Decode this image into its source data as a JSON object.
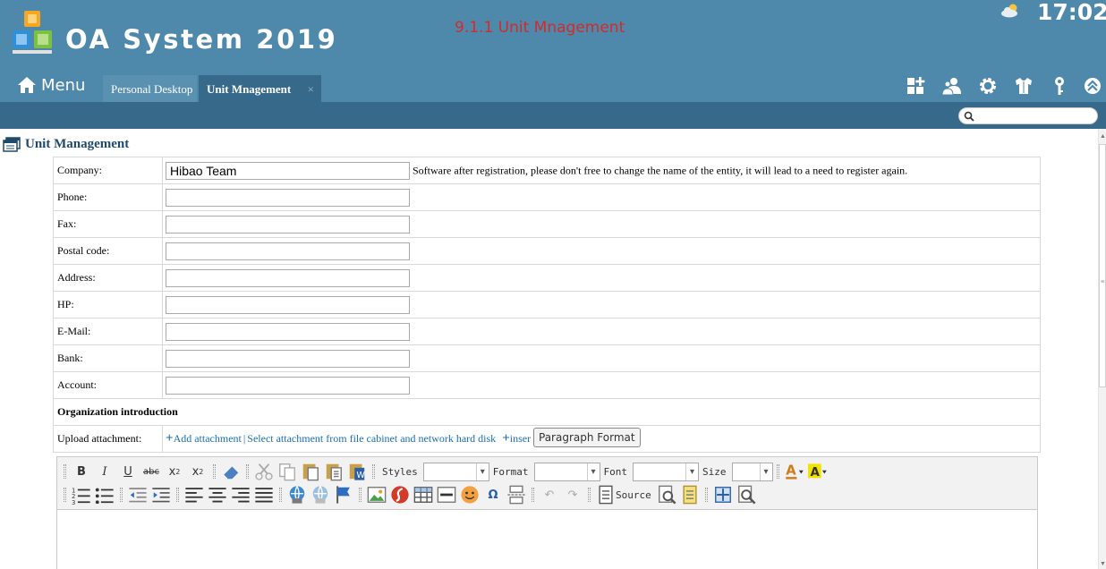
{
  "header": {
    "app_title": "OA System 2019",
    "page_heading": "9.1.1 Unit Mnagement",
    "clock": "17:02",
    "menu_label": "Menu"
  },
  "tabs": [
    {
      "label": "Personal Desktop",
      "active": false
    },
    {
      "label": "Unit Mnagement",
      "active": true,
      "close": "×"
    }
  ],
  "search": {
    "placeholder": ""
  },
  "section": {
    "title": "Unit Management"
  },
  "form": {
    "company_label": "Company:",
    "company_value": "Hibao Team",
    "company_note": "Software after registration, please don't free to change the name of the entity, it will lead to a need to register again.",
    "fields": [
      {
        "label": "Phone:",
        "value": ""
      },
      {
        "label": "Fax:",
        "value": ""
      },
      {
        "label": "Postal code:",
        "value": ""
      },
      {
        "label": "Address:",
        "value": ""
      },
      {
        "label": "HP:",
        "value": ""
      },
      {
        "label": "E-Mail:",
        "value": ""
      },
      {
        "label": "Bank:",
        "value": ""
      },
      {
        "label": "Account:",
        "value": ""
      }
    ],
    "org_intro_label": "Organization introduction",
    "upload_label": "Upload attachment:",
    "add_attachment": "Add attachment",
    "select_attachment": "Select attachment from file cabinet and network hard disk",
    "insert_link": "inser",
    "tooltip": "Paragraph Format"
  },
  "editor": {
    "styles_label": "Styles",
    "format_label": "Format",
    "font_label": "Font",
    "size_label": "Size",
    "source_label": "Source",
    "styles_value": "",
    "format_value": "",
    "font_value": "",
    "size_value": ""
  },
  "colors": {
    "header_bg": "#4e88ab",
    "subbar_bg": "#37698a",
    "heading_red": "#d42a2a",
    "link_blue": "#1a6fb3"
  }
}
